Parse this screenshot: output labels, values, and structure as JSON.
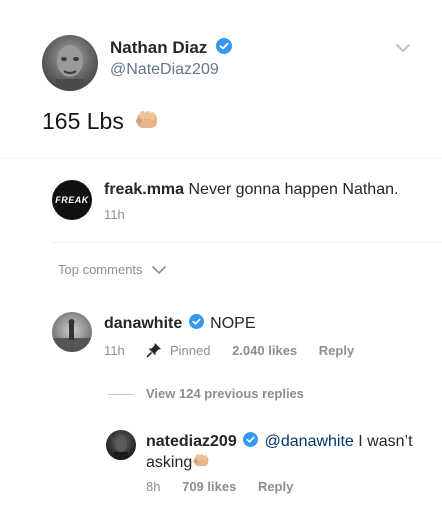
{
  "tweet": {
    "author_name": "Nathan Diaz",
    "author_handle": "@NateDiaz209",
    "text": "165 Lbs"
  },
  "caption": {
    "username": "freak.mma",
    "text": "Never gonna happen Nathan.",
    "time": "11h",
    "avatar_text": "FREAK"
  },
  "comments_header": {
    "label": "Top comments"
  },
  "comments": [
    {
      "username": "danawhite",
      "text": "NOPE",
      "time": "11h",
      "pinned_label": "Pinned",
      "likes": "2.040 likes",
      "reply_label": "Reply"
    }
  ],
  "view_replies": "View 124 previous replies",
  "reply": {
    "username": "natediaz209",
    "mention": "@danawhite",
    "text_line1": "I wasn’t",
    "text_line2": "asking",
    "time": "8h",
    "likes": "709 likes",
    "reply_label": "Reply"
  },
  "colors": {
    "text": "#262626",
    "muted": "#8e8e8e",
    "verified": "#3897f0",
    "divider": "#efefef"
  },
  "icons": [
    "verified-badge-icon",
    "chevron-down-icon",
    "fist-emoji-icon",
    "pin-icon"
  ]
}
